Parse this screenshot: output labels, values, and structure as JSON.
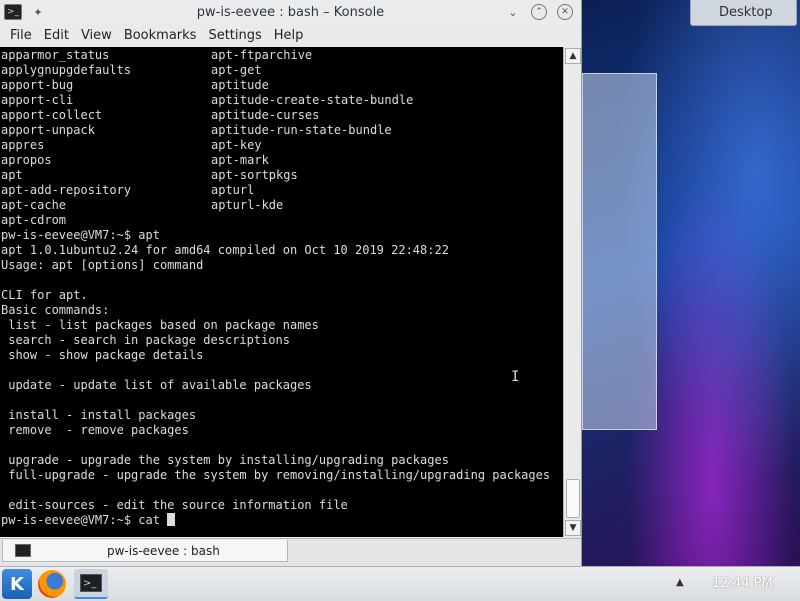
{
  "desktop": {
    "label": "Desktop"
  },
  "window": {
    "title": "pw-is-eevee : bash – Konsole",
    "menu": [
      "File",
      "Edit",
      "View",
      "Bookmarks",
      "Settings",
      "Help"
    ]
  },
  "terminal": {
    "columns": [
      [
        "apparmor_status",
        "apt-ftparchive"
      ],
      [
        "applygnupgdefaults",
        "apt-get"
      ],
      [
        "apport-bug",
        "aptitude"
      ],
      [
        "apport-cli",
        "aptitude-create-state-bundle"
      ],
      [
        "apport-collect",
        "aptitude-curses"
      ],
      [
        "apport-unpack",
        "aptitude-run-state-bundle"
      ],
      [
        "appres",
        "apt-key"
      ],
      [
        "apropos",
        "apt-mark"
      ],
      [
        "apt",
        "apt-sortpkgs"
      ],
      [
        "apt-add-repository",
        "apturl"
      ],
      [
        "apt-cache",
        "apturl-kde"
      ],
      [
        "apt-cdrom",
        ""
      ]
    ],
    "lines": [
      "pw-is-eevee@VM7:~$ apt",
      "apt 1.0.1ubuntu2.24 for amd64 compiled on Oct 10 2019 22:48:22",
      "Usage: apt [options] command",
      "",
      "CLI for apt.",
      "Basic commands:",
      " list - list packages based on package names",
      " search - search in package descriptions",
      " show - show package details",
      "",
      " update - update list of available packages",
      "",
      " install - install packages",
      " remove  - remove packages",
      "",
      " upgrade - upgrade the system by installing/upgrading packages",
      " full-upgrade - upgrade the system by removing/installing/upgrading packages",
      "",
      " edit-sources - edit the source information file"
    ],
    "prompt": "pw-is-eevee@VM7:~$ cat "
  },
  "tab": {
    "label": "pw-is-eevee : bash"
  },
  "taskbar": {
    "clock": "12:44 PM"
  }
}
